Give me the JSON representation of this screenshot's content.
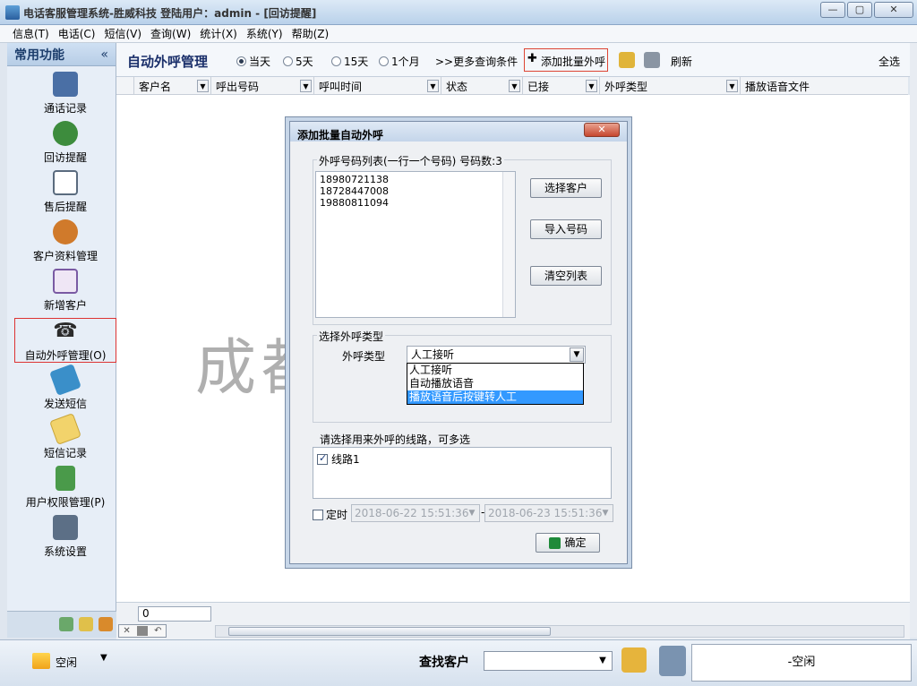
{
  "window": {
    "title": "电话客服管理系统-胜威科技  登陆用户：admin - [回访提醒]",
    "minimize": "—",
    "maximize": "▢",
    "close": "✕"
  },
  "menu": [
    "信息(T)",
    "电话(C)",
    "短信(V)",
    "查询(W)",
    "统计(X)",
    "系统(Y)",
    "帮助(Z)"
  ],
  "sidebar": {
    "title": "常用功能",
    "collapse": "«",
    "items": [
      {
        "label": "通话记录",
        "icon": "phone-icon",
        "color": "#4a6fa5"
      },
      {
        "label": "回访提醒",
        "icon": "user-callback-icon",
        "color": "#3d8c3d"
      },
      {
        "label": "售后提醒",
        "icon": "checklist-icon",
        "color": "#5a6b7e"
      },
      {
        "label": "客户资料管理",
        "icon": "customers-icon",
        "color": "#d07a2b"
      },
      {
        "label": "新增客户",
        "icon": "id-card-icon",
        "color": "#7a5aa3"
      },
      {
        "label": "自动外呼管理(O)",
        "icon": "outbound-call-icon",
        "color": "#2b2b2b"
      },
      {
        "label": "发送短信",
        "icon": "sms-phone-icon",
        "color": "#3a8fc9"
      },
      {
        "label": "短信记录",
        "icon": "envelope-icon",
        "color": "#c9a53a"
      },
      {
        "label": "用户权限管理(P)",
        "icon": "permission-icon",
        "color": "#4a9a4a"
      },
      {
        "label": "系统设置",
        "icon": "settings-icon",
        "color": "#5c6f86"
      }
    ]
  },
  "toolbar": {
    "title": "自动外呼管理",
    "radios": [
      {
        "label": "当天",
        "checked": true
      },
      {
        "label": "5天",
        "checked": false
      },
      {
        "label": "15天",
        "checked": false
      },
      {
        "label": "1个月",
        "checked": false
      }
    ],
    "more_conditions": ">>更多查询条件",
    "add_batch": "添加批量外呼",
    "add_symbol": "✚",
    "refresh": "刷新",
    "select_all": "全选"
  },
  "grid": {
    "columns": [
      "客户名",
      "呼出号码",
      "呼叫时间",
      "状态",
      "已接",
      "外呼类型",
      "播放语音文件"
    ],
    "count": "0"
  },
  "watermark": "成都胜威科技",
  "dialog": {
    "title": "添加批量自动外呼",
    "close": "✕",
    "list_legend": "外呼号码列表(一行一个号码) 号码数:3",
    "numbers": [
      "18980721138",
      "18728447008",
      "19880811094"
    ],
    "buttons": {
      "select_customer": "选择客户",
      "import_numbers": "导入号码",
      "clear_list": "清空列表",
      "confirm": "确定"
    },
    "type_legend": "选择外呼类型",
    "type_label": "外呼类型",
    "type_value": "人工接听",
    "type_options": [
      "人工接听",
      "自动播放语音",
      "播放语音后按键转人工"
    ],
    "lines_label": "请选择用来外呼的线路，可多选",
    "lines": [
      {
        "label": "线路1",
        "checked": true
      }
    ],
    "timer_label": "定时",
    "start_time": "2018-06-22 15:51:36",
    "end_time": "2018-06-23 15:51:36",
    "dash": "-"
  },
  "statusbar": {
    "state": "空闲",
    "find_label": "查找客户",
    "find_value": "",
    "right_status": "-空闲"
  }
}
